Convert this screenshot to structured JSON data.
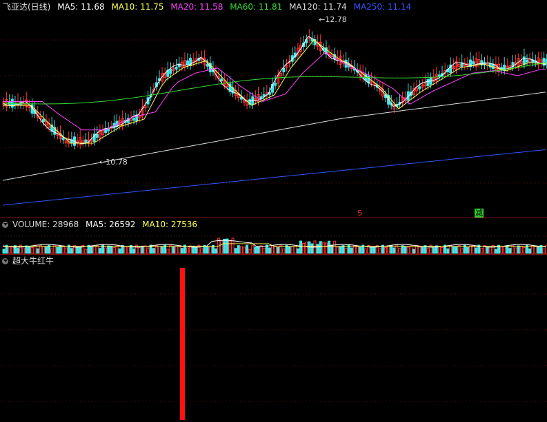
{
  "header": {
    "title": "飞亚达(日线)",
    "ma": [
      {
        "label": "MA5: 11.68",
        "color": "#ffffff"
      },
      {
        "label": "MA10: 11.75",
        "color": "#ffff55"
      },
      {
        "label": "MA20: 11.58",
        "color": "#ff44ff"
      },
      {
        "label": "MA60: 11.81",
        "color": "#33dd33"
      },
      {
        "label": "MA120: 11.74",
        "color": "#dddddd"
      },
      {
        "label": "MA250: 11.14",
        "color": "#3355ff"
      }
    ]
  },
  "price_chart": {
    "high_label": "12.78",
    "low_label": "10.78",
    "marker_s": "S",
    "marker_jian": "减",
    "colors": {
      "up": "#ff3333",
      "down": "#44e5e5",
      "ma5": "#ffffff",
      "ma10": "#ffff55",
      "ma20": "#ff44ff",
      "ma60": "#33dd33",
      "ma120": "#dddddd",
      "ma250": "#3355ff"
    }
  },
  "volume": {
    "label": "VOLUME: 28968",
    "ma5_label": "MA5: 26592",
    "ma10_label": "MA10: 27536"
  },
  "indicator": {
    "title": "超大牛红牛",
    "bar_color": "#ff1111"
  }
}
